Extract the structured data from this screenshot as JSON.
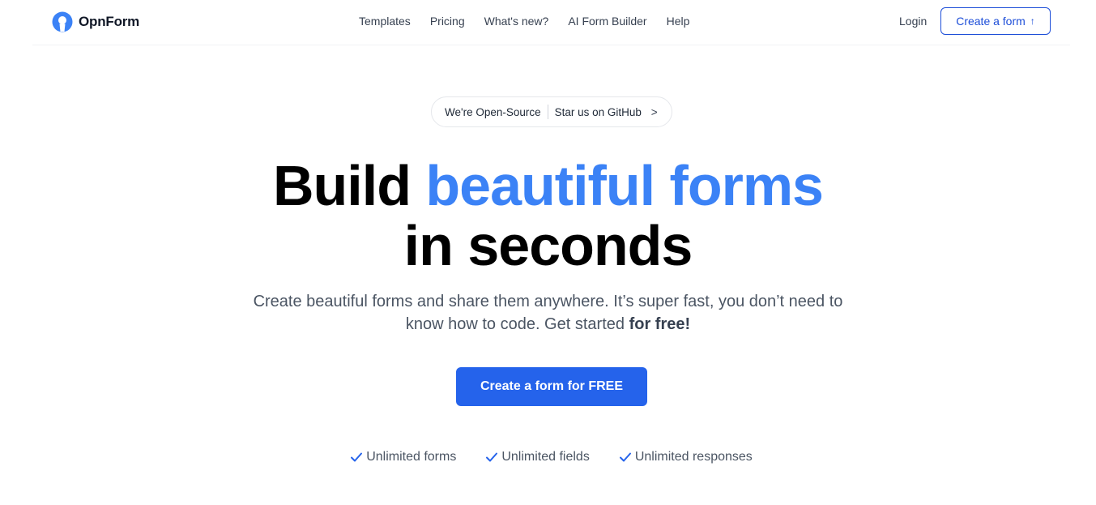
{
  "brand": {
    "name": "OpnForm",
    "logo_icon": "opnform-logo-icon",
    "color": "#3b82f6"
  },
  "nav": {
    "links": [
      "Templates",
      "Pricing",
      "What's new?",
      "AI Form Builder",
      "Help"
    ],
    "login_label": "Login",
    "create_label": "Create a form",
    "create_icon": "arrow-up-icon"
  },
  "announcement": {
    "left_text": "We're Open-Source",
    "right_text": "Star us on GitHub",
    "chevron": ">"
  },
  "hero": {
    "title_part1": "Build",
    "title_accent": "beautiful forms",
    "title_line2": "in seconds",
    "subtitle_text": "Create beautiful forms and share them anywhere. It’s super fast, you don’t need to know how to code. Get started",
    "subtitle_bold": "for free!",
    "cta_label": "Create a form for FREE"
  },
  "features": [
    {
      "icon": "check-icon",
      "label": "Unlimited forms"
    },
    {
      "icon": "check-icon",
      "label": "Unlimited fields"
    },
    {
      "icon": "check-icon",
      "label": "Unlimited responses"
    }
  ],
  "colors": {
    "accent": "#3b82f6",
    "primary_button": "#2563eb",
    "outline_button": "#1d4ed8"
  }
}
